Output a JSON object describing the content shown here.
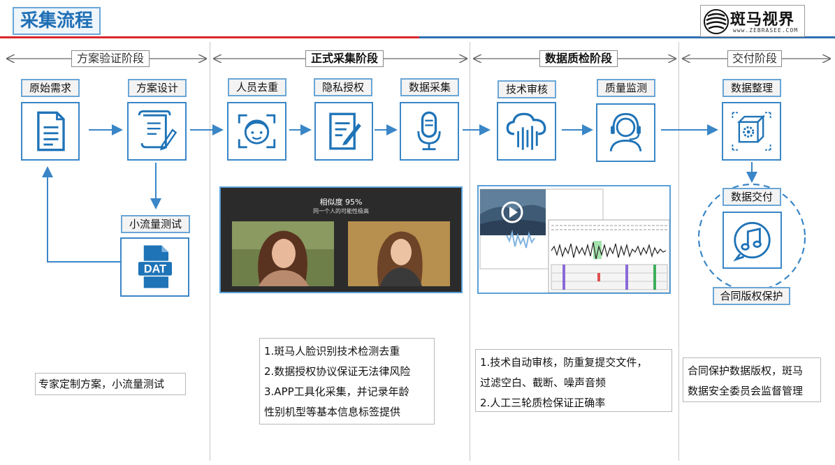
{
  "title": "采集流程",
  "logo": {
    "name": "斑马视界",
    "url": "www.ZEBRASEE.COM"
  },
  "phases": [
    "方案验证阶段",
    "正式采集阶段",
    "数据质检阶段",
    "交付阶段"
  ],
  "nodes": {
    "original_requirements": "原始需求",
    "plan_design": "方案设计",
    "small_traffic_test": "小流量测试",
    "person_dedup": "人员去重",
    "privacy_authorization": "隐私授权",
    "data_collection": "数据采集",
    "technical_review": "技术审核",
    "quality_monitoring": "质量监测",
    "data_organization": "数据整理",
    "data_delivery": "数据交付",
    "copyright_protection": "合同版权保护"
  },
  "icons": {
    "dat_label": "DAT"
  },
  "face_compare": {
    "similarity": "相似度 95%",
    "caption": "同一个人的可能性极高"
  },
  "descriptions": {
    "phase1": "专家定制方案，小流量测试",
    "phase2": [
      "1.斑马人脸识别技术检测去重",
      "2.数据授权协议保证无法律风险",
      "3.APP工具化采集，并记录年龄",
      "性别机型等基本信息标签提供"
    ],
    "phase3": [
      "1.技术自动审核，防重复提交文件，",
      "过滤空白、截断、噪声音频",
      "2.人工三轮质检保证正确率"
    ],
    "phase4": [
      "合同保护数据版权，斑马",
      "数据安全委员会监督管理"
    ]
  },
  "colors": {
    "accent_blue": "#3a86c7",
    "brand_red": "#d9262c",
    "title_blue": "#1f6fb5"
  }
}
